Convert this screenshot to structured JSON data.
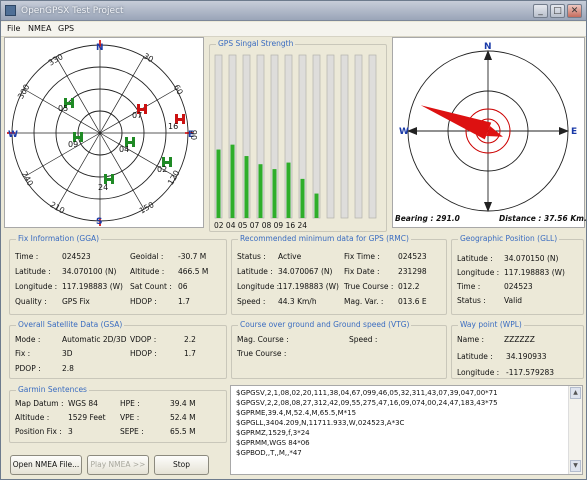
{
  "window": {
    "title": "OpenGPSX Test Project"
  },
  "menu": [
    "File",
    "NMEA",
    "GPS"
  ],
  "sky_view": {
    "compass": [
      "N",
      "E",
      "S",
      "W"
    ],
    "degrees": [
      "30",
      "60",
      "90",
      "120",
      "150",
      "210",
      "240",
      "300",
      "330"
    ],
    "satellites": [
      {
        "id": "05",
        "color": "green"
      },
      {
        "id": "09",
        "color": "green"
      },
      {
        "id": "07",
        "color": "red"
      },
      {
        "id": "16",
        "color": "red"
      },
      {
        "id": "04",
        "color": "green"
      },
      {
        "id": "02",
        "color": "green"
      },
      {
        "id": "24",
        "color": "green"
      }
    ]
  },
  "signal": {
    "title": "GPS Singal Strength",
    "ids_text": "02 04 05 07 08 09 16 24",
    "levels": [
      0.42,
      0.45,
      0.38,
      0.33,
      0.3,
      0.34,
      0.24,
      0.15,
      0,
      0,
      0,
      0
    ]
  },
  "compass_view": {
    "labels": [
      "N",
      "E",
      "S",
      "W"
    ],
    "bearing_label": "Bearing : 291.0",
    "distance_label": "Distance : 37.56 Km.",
    "bearing": 291.0
  },
  "fix": {
    "title": "Fix Information (GGA)",
    "time_l": "Time :",
    "time_v": "024523",
    "lat_l": "Latitude :",
    "lat_v": "34.070100 (N)",
    "lon_l": "Longitude :",
    "lon_v": "117.198883 (W)",
    "quality_l": "Quality :",
    "quality_v": "GPS Fix",
    "geoidal_l": "Geoidal :",
    "geoidal_v": "-30.7 M",
    "alt_l": "Altitude :",
    "alt_v": "466.5 M",
    "satcount_l": "Sat Count :",
    "satcount_v": "06",
    "hdop_l": "HDOP :",
    "hdop_v": "1.7"
  },
  "rmc": {
    "title": "Recommended minimum data for GPS (RMC)",
    "status_l": "Status :",
    "status_v": "Active",
    "lat_l": "Latitude :",
    "lat_v": "34.070067 (N)",
    "lon_l": "Longitude :",
    "lon_v": "117.198883 (W)",
    "speed_l": "Speed :",
    "speed_v": "44.3 Km/h",
    "fixtime_l": "Fix Time :",
    "fixtime_v": "024523",
    "fixdate_l": "Fix Date :",
    "fixdate_v": "231298",
    "course_l": "True Course :",
    "course_v": "012.2",
    "magvar_l": "Mag. Var. :",
    "magvar_v": "013.6 E"
  },
  "gll": {
    "title": "Geographic Position (GLL)",
    "lat_l": "Latitude :",
    "lat_v": "34.070150 (N)",
    "lon_l": "Longitude :",
    "lon_v": "117.198883 (W)",
    "time_l": "Time :",
    "time_v": "024523",
    "status_l": "Status :",
    "status_v": "Valid"
  },
  "gsa": {
    "title": "Overall Satellite Data (GSA)",
    "mode_l": "Mode :",
    "mode_v": "Automatic 2D/3D",
    "fix_l": "Fix :",
    "fix_v": "3D",
    "pdop_l": "PDOP :",
    "pdop_v": "2.8",
    "vdop_l": "VDOP :",
    "vdop_v": "2.2",
    "hdop_l": "HDOP :",
    "hdop_v": "1.7"
  },
  "vtg": {
    "title": "Course over ground and Ground speed (VTG)",
    "mag_l": "Mag. Course :",
    "true_l": "True Course :",
    "speed_l": "Speed :"
  },
  "wpl": {
    "title": "Way point (WPL)",
    "name_l": "Name :",
    "name_v": "ZZZZZZ",
    "lat_l": "Latitude :",
    "lat_v": "34.190933",
    "lon_l": "Longitude :",
    "lon_v": "-117.579283"
  },
  "garmin": {
    "title": "Garmin Sentences",
    "datum_l": "Map Datum :",
    "datum_v": "WGS 84",
    "alt_l": "Altitude :",
    "alt_v": "1529 Feet",
    "posfix_l": "Position Fix :",
    "posfix_v": "3",
    "hpe_l": "HPE :",
    "hpe_v": "39.4 M",
    "vpe_l": "VPE :",
    "vpe_v": "52.4 M",
    "sepe_l": "SEPE :",
    "sepe_v": "65.5 M"
  },
  "nmea_lines": [
    "$GPGSV,2,1,08,02,20,111,38,04,67,099,46,05,32,311,43,07,39,047,00*71",
    "$GPGSV,2,2,08,08,27,312,42,09,55,275,47,16,09,074,00,24,47,183,43*75",
    "$GPRME,39.4,M,52.4,M,65.5,M*15",
    "$GPGLL,3404.209,N,11711.933,W,024523,A*3C",
    "$GPRMZ,1529,f,3*24",
    "$GPRMM,WGS 84*06",
    "$GPBOD,,T,,M,,*47"
  ],
  "buttons": {
    "open": "Open NMEA File...",
    "play": "Play NMEA >>",
    "stop": "Stop"
  }
}
